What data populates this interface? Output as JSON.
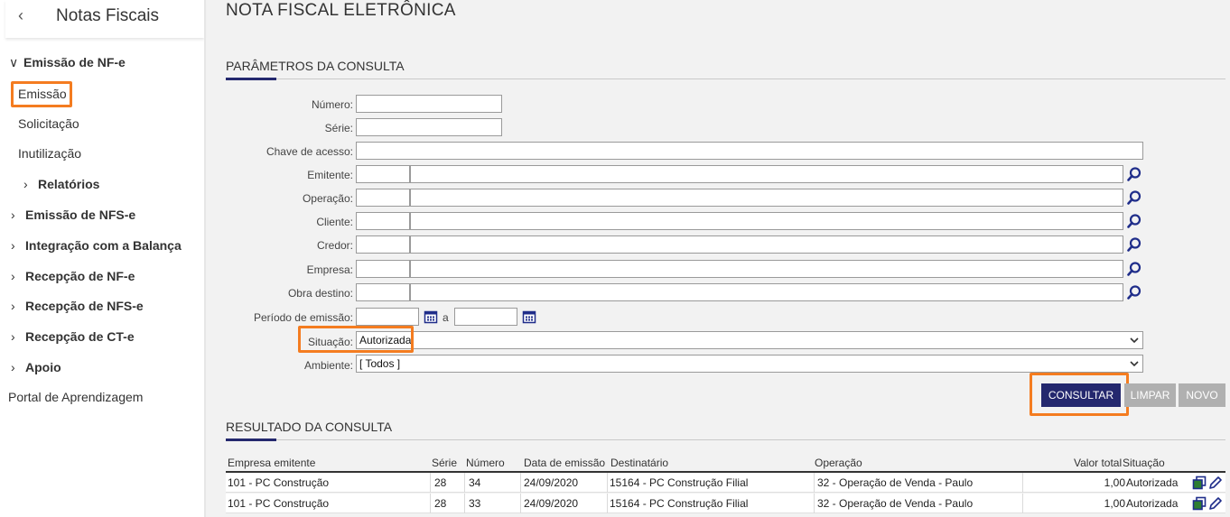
{
  "sidebar": {
    "back_icon": "chevron-left-icon",
    "title": "Notas Fiscais",
    "items": [
      {
        "label": "Emissão de NF-e",
        "type": "group",
        "expanded": true
      },
      {
        "label": "Emissão",
        "type": "item",
        "selected": true
      },
      {
        "label": "Solicitação",
        "type": "item"
      },
      {
        "label": "Inutilização",
        "type": "item"
      },
      {
        "label": "Relatórios",
        "type": "subgroup"
      },
      {
        "label": "Emissão de NFS-e",
        "type": "group"
      },
      {
        "label": "Integração com a Balança",
        "type": "group"
      },
      {
        "label": "Recepção de NF-e",
        "type": "group"
      },
      {
        "label": "Recepção de NFS-e",
        "type": "group"
      },
      {
        "label": "Recepção de CT-e",
        "type": "group"
      },
      {
        "label": "Apoio",
        "type": "group"
      },
      {
        "label": "Portal de Aprendizagem",
        "type": "link"
      }
    ]
  },
  "main": {
    "title": "NOTA FISCAL ELETRÔNICA",
    "params_title": "PARÂMETROS DA CONSULTA",
    "results_title": "RESULTADO DA CONSULTA"
  },
  "form": {
    "numero": {
      "label": "Número:",
      "value": ""
    },
    "serie": {
      "label": "Série:",
      "value": ""
    },
    "chave": {
      "label": "Chave de acesso:",
      "value": ""
    },
    "emitente": {
      "label": "Emitente:",
      "code": "",
      "name": ""
    },
    "operacao": {
      "label": "Operação:",
      "code": "",
      "name": ""
    },
    "cliente": {
      "label": "Cliente:",
      "code": "",
      "name": ""
    },
    "credor": {
      "label": "Credor:",
      "code": "",
      "name": ""
    },
    "empresa": {
      "label": "Empresa:",
      "code": "",
      "name": ""
    },
    "obra": {
      "label": "Obra destino:",
      "code": "",
      "name": ""
    },
    "periodo": {
      "label": "Período de emissão:",
      "from": "",
      "separator": "a",
      "to": ""
    },
    "situacao": {
      "label": "Situação:",
      "value": "Autorizada"
    },
    "ambiente": {
      "label": "Ambiente:",
      "value": "[ Todos ]"
    }
  },
  "buttons": {
    "consultar": "CONSULTAR",
    "limpar": "LIMPAR",
    "novo": "NOVO"
  },
  "table": {
    "columns": [
      "Empresa emitente",
      "Série",
      "Número",
      "Data de emissão",
      "Destinatário",
      "Operação",
      "Valor total",
      "Situação"
    ],
    "rows": [
      [
        "101 - PC Construção",
        "28",
        "34",
        "24/09/2020",
        "15164 - PC Construção Filial",
        "32 - Operação de Venda - Paulo",
        "1,00",
        "Autorizada"
      ],
      [
        "101 - PC Construção",
        "28",
        "33",
        "24/09/2020",
        "15164 - PC Construção Filial",
        "32 - Operação de Venda - Paulo",
        "1,00",
        "Autorizada"
      ]
    ]
  },
  "colors": {
    "accent": "#24286e",
    "highlight": "#f47c20",
    "icon_blue": "#1f2d8a",
    "icon_green": "#2e7d32"
  }
}
